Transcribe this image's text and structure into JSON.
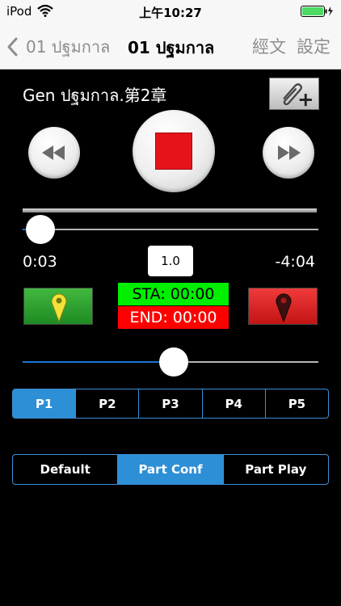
{
  "status_bar": {
    "carrier": "iPod",
    "time": "上午10:27",
    "icons": [
      "wifi-icon",
      "battery-icon",
      "charging-icon"
    ]
  },
  "nav": {
    "back_label": "01 ปฐมกาล",
    "title": "01 ปฐมกาล",
    "right_buttons": [
      "經文",
      "設定"
    ]
  },
  "player": {
    "chapter_title": "Gen ปฐมกาล.第2章",
    "elapsed": "0:03",
    "remaining": "-4:04",
    "speed": "1.0",
    "progress_fraction": 0.06,
    "volume_fraction": 0.51
  },
  "markers": {
    "start_label": "STA: 00:00",
    "end_label": "END: 00:00"
  },
  "parts": {
    "items": [
      "P1",
      "P2",
      "P3",
      "P4",
      "P5"
    ],
    "selected": "P1"
  },
  "modes": {
    "items": [
      "Default",
      "Part Conf",
      "Part Play"
    ],
    "selected": "Part Conf"
  },
  "colors": {
    "accent": "#2d8fd5",
    "stop": "#e4141a",
    "start_marker": "#00ee00",
    "end_marker": "#ff0000"
  }
}
